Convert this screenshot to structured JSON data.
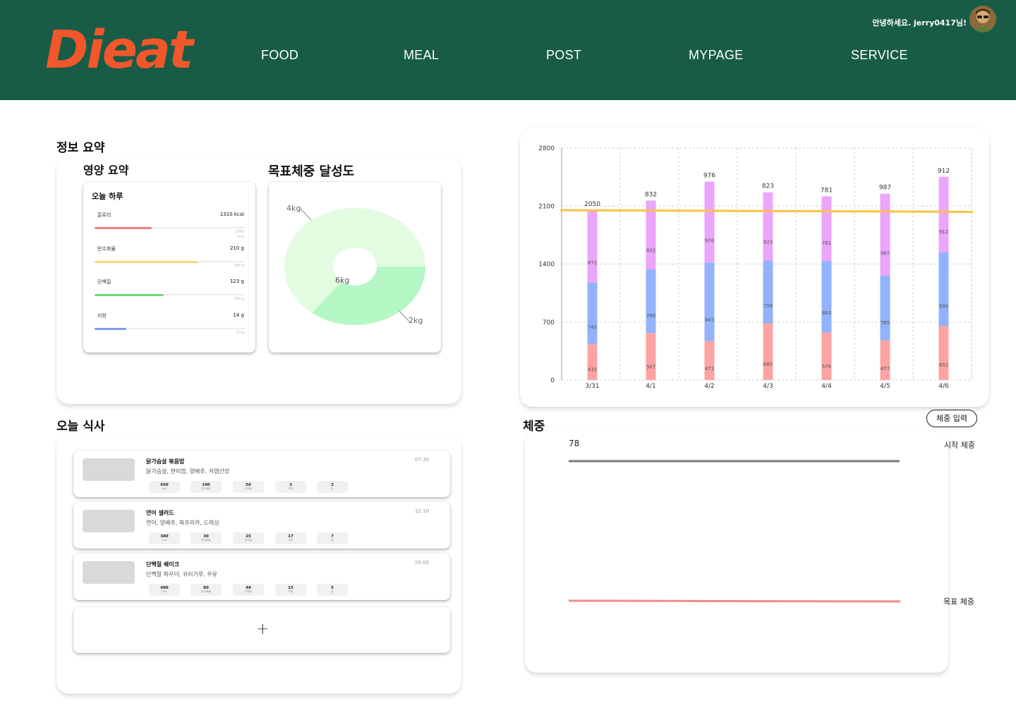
{
  "header": {
    "logo_text": "Dieat",
    "nav": [
      "FOOD",
      "MEAL",
      "POST",
      "MYPAGE",
      "SERVICE"
    ],
    "greeting": "안녕하세요. jerry0417님!"
  },
  "summary": {
    "title": "정보 요약",
    "nutrition_title": "영양 요약",
    "goal_title": "목표체중 달성도",
    "today_title": "오늘 하루",
    "nutrients": [
      {
        "label": "칼로리",
        "value": "1310 kcal",
        "goal": "2000 kcal",
        "ratio": 0.38,
        "color": "#f07c7c"
      },
      {
        "label": "탄수화물",
        "value": "210 g",
        "goal": "300 g",
        "ratio": 0.69,
        "color": "#fbd97a"
      },
      {
        "label": "단백질",
        "value": "123 g",
        "goal": "200 g",
        "ratio": 0.46,
        "color": "#6fdc73"
      },
      {
        "label": "지방",
        "value": "14 g",
        "goal": "50 g",
        "ratio": 0.21,
        "color": "#7f9cf2"
      }
    ]
  },
  "goal_donut": {
    "labels": [
      "4kg",
      "6kg",
      "2kg"
    ],
    "achieved_kg": 2,
    "remaining_kg": 4,
    "total_kg": 6,
    "colors": {
      "remaining": "#e3fbe0",
      "achieved": "#b5f7c4"
    }
  },
  "meals": {
    "title": "오늘 식사",
    "chip_units": [
      "kcal",
      "탄수화물",
      "단백질",
      "지방",
      "당"
    ],
    "items": [
      {
        "name": "닭가슴살 볶음밥",
        "ingredients": "닭가슴살, 현미밥, 양배추, 저염간장",
        "time": "07:30",
        "values": [
          "450",
          "100",
          "50",
          "3",
          "2"
        ]
      },
      {
        "name": "연어 샐러드",
        "ingredients": "연어, 양배추, 파프리카, 드레싱",
        "time": "12:10",
        "values": [
          "380",
          "30",
          "25",
          "17",
          "7"
        ]
      },
      {
        "name": "단백질 쉐이크",
        "ingredients": "단백질 파우더, 귀리가루, 우유",
        "time": "20:00",
        "values": [
          "480",
          "80",
          "48",
          "15",
          "5"
        ]
      }
    ],
    "add_label": "+"
  },
  "chart_data": {
    "type": "bar",
    "stacked": true,
    "categories": [
      "3/31",
      "4/1",
      "4/2",
      "4/3",
      "4/4",
      "4/5",
      "4/6"
    ],
    "series": [
      {
        "values": [
          432,
          567,
          471,
          685,
          574,
          477,
          651
        ],
        "color": "#fda3a3"
      },
      {
        "values": [
          745,
          768,
          947,
          758,
          863,
          785,
          890
        ],
        "color": "#92b2fc"
      },
      {
        "values": [
          872,
          832,
          976,
          823,
          781,
          987,
          912
        ],
        "color": "#eba5fb"
      }
    ],
    "top_labels": [
      "2050",
      "832",
      "976",
      "823",
      "781",
      "987",
      "912"
    ],
    "target_line": {
      "value": 2050,
      "end_value": 2030,
      "color": "#f7c347"
    },
    "ylim": [
      0,
      2800
    ],
    "yticks": [
      0,
      700,
      1400,
      2100,
      2800
    ],
    "grid": true
  },
  "weight": {
    "title": "체중",
    "button_label": "체중 입력",
    "start_value": "78",
    "start_label": "시작 체중",
    "goal_label": "목표 체중",
    "colors": {
      "start": "#7a7a7a",
      "goal": "#f58b8b"
    }
  }
}
